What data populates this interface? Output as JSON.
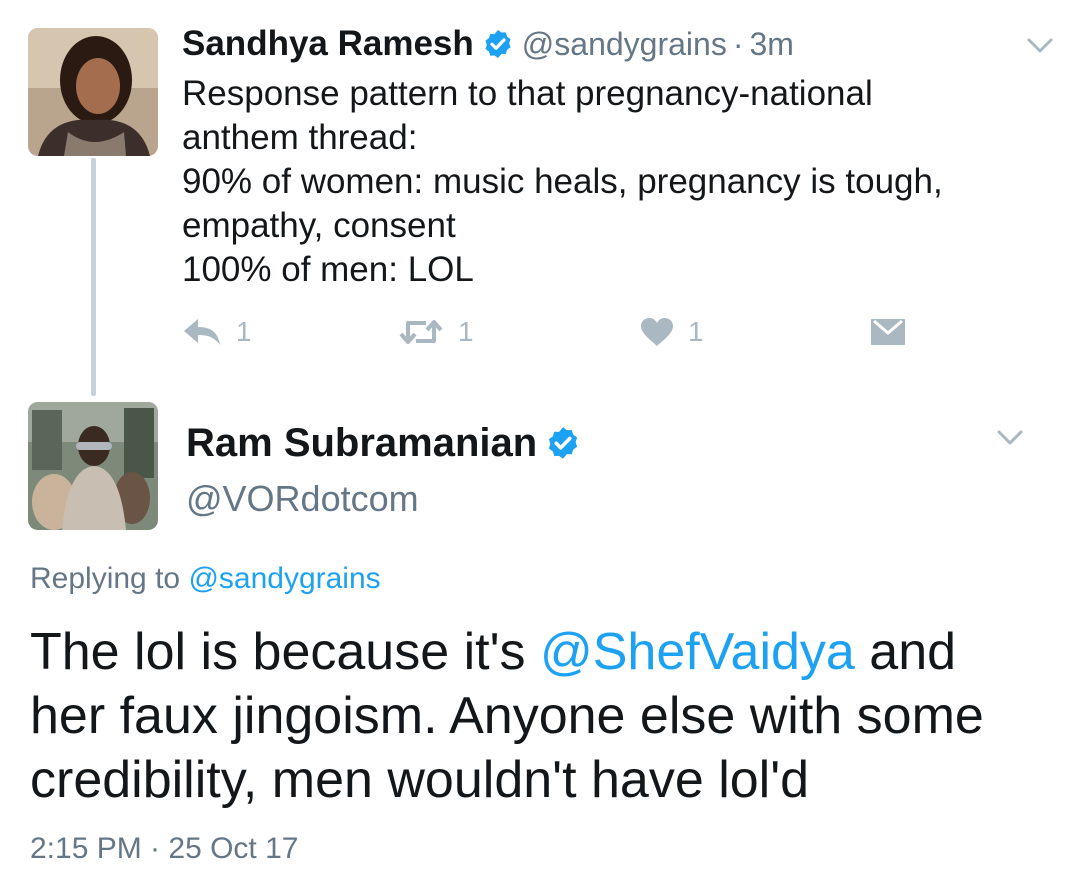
{
  "tweet_parent": {
    "author_name": "Sandhya Ramesh",
    "handle": "@sandygrains",
    "separator": "·",
    "time": "3m",
    "body_lines": [
      "Response pattern to that pregnancy-national",
      "anthem thread:",
      "90% of women: music heals, pregnancy is tough,",
      "empathy, consent",
      "100% of men: LOL"
    ],
    "reply_count": "1",
    "retweet_count": "1",
    "like_count": "1",
    "icons": [
      "reply-icon",
      "retweet-icon",
      "heart-icon",
      "dm-icon",
      "chevron-down-icon",
      "verified-badge-icon"
    ]
  },
  "tweet_focus": {
    "author_name": "Ram Subramanian",
    "handle": "@VORdotcom",
    "replying_prefix": "Replying to ",
    "replying_handle": "@sandygrains",
    "body": {
      "line1_before": "The lol is because it's ",
      "line1_mention": "@ShefVaidya",
      "line1_after": " and",
      "line2": "her faux jingoism. Anyone else with some",
      "line3": "credibility, men wouldn't have lol'd"
    },
    "timestamp": "2:15 PM · 25 Oct 17"
  },
  "colors": {
    "link": "#1da1f2",
    "secondary_text": "#657786",
    "action_icon": "#aab8c2",
    "verified": "#1da1f2",
    "thread_line": "#c8d2da"
  }
}
